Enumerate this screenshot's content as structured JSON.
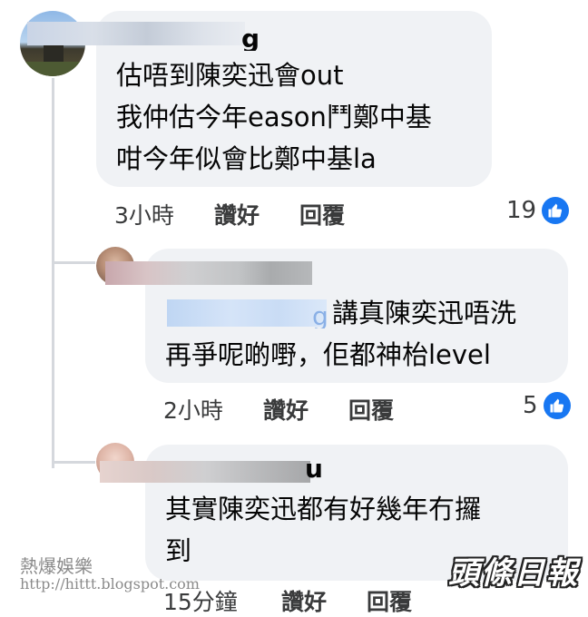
{
  "comments": [
    {
      "name_fragment": "g",
      "text": "估唔到陳奕迅會out\n我仲估今年eason鬥鄭中基\n咁今年似會比鄭中基la",
      "time": "3小時",
      "like_label": "讚好",
      "reply_label": "回覆",
      "likes": "19"
    },
    {
      "mention_fragment": "g",
      "text": "講真陳奕迅唔洗\n再爭呢啲嘢，佢都神枱level",
      "time": "2小時",
      "like_label": "讚好",
      "reply_label": "回覆",
      "likes": "5"
    },
    {
      "name_fragment": "u",
      "text": "其實陳奕迅都有好幾年冇攞\n到",
      "time": "15分鐘",
      "like_label": "讚好",
      "reply_label": "回覆"
    }
  ],
  "watermark": {
    "line1": "熱爆娛樂",
    "line2": "http://hittt.blogspot.com"
  },
  "logo_text": "頭條日報",
  "colors": {
    "bubble": "#f0f2f5",
    "like_blue": "#1877f2",
    "thread_line": "#d5d8dd"
  }
}
